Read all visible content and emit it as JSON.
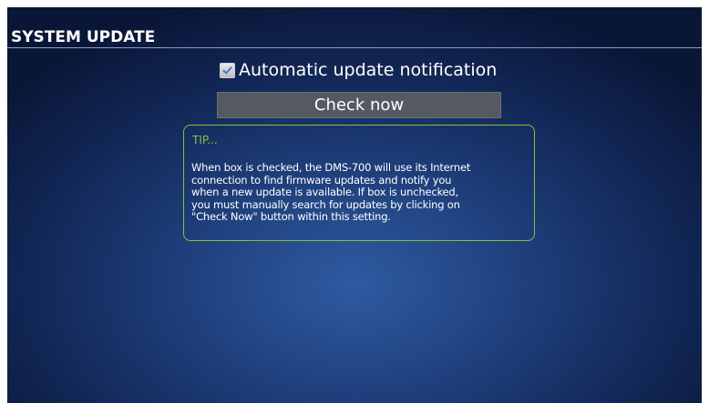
{
  "header": {
    "title": "SYSTEM UPDATE"
  },
  "settings": {
    "auto_update": {
      "label": "Automatic update notification",
      "checked": true
    },
    "check_now_label": "Check now"
  },
  "tip": {
    "title": "TIP...",
    "lines": [
      "When box is checked, the DMS-700 will use its Internet",
      "connection to find firmware updates and notify you",
      "when a new update is available. If box is unchecked,",
      "you must manually search for updates by clicking on",
      "\"Check Now\" button within this setting."
    ]
  },
  "colors": {
    "tip_accent": "#86c041",
    "button_bg": "#555a62",
    "background": "#1f3f7c"
  }
}
